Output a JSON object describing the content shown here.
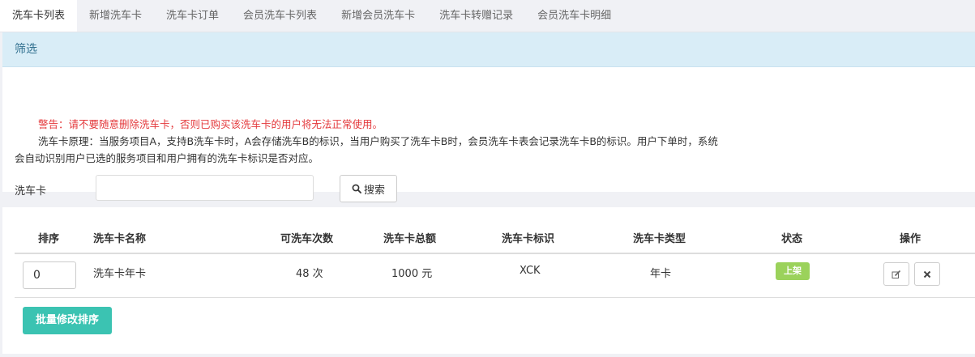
{
  "tabs": [
    {
      "label": "洗车卡列表",
      "active": true
    },
    {
      "label": "新增洗车卡"
    },
    {
      "label": "洗车卡订单"
    },
    {
      "label": "会员洗车卡列表"
    },
    {
      "label": "新增会员洗车卡"
    },
    {
      "label": "洗车卡转赠记录"
    },
    {
      "label": "会员洗车卡明细"
    }
  ],
  "filter": {
    "title": "筛选",
    "warning": "警告：请不要随意删除洗车卡，否则已购买该洗车卡的用户将无法正常使用。",
    "note": "洗车卡原理：当服务项目A，支持B洗车卡时，A会存储洗车B的标识，当用户购买了洗车卡B时，会员洗车卡表会记录洗车卡B的标识。用户下单时，系统会自动识别用户已选的服务项目和用户拥有的洗车卡标识是否对应。",
    "card_label": "洗车卡",
    "card_value": "",
    "search_label": "搜索",
    "search_icon": "search-icon"
  },
  "table": {
    "headers": [
      "排序",
      "洗车卡名称",
      "可洗车次数",
      "洗车卡总额",
      "洗车卡标识",
      "洗车卡类型",
      "状态",
      "操作"
    ],
    "rows": [
      {
        "sort": "0",
        "name": "洗车卡年卡",
        "times": "48 次",
        "amount": "1000 元",
        "code": "XCK",
        "type": "年卡",
        "status": "上架"
      }
    ],
    "batch_label": "批量修改排序",
    "status_color": "#9bd25b",
    "batch_color": "#3bc3b2"
  }
}
